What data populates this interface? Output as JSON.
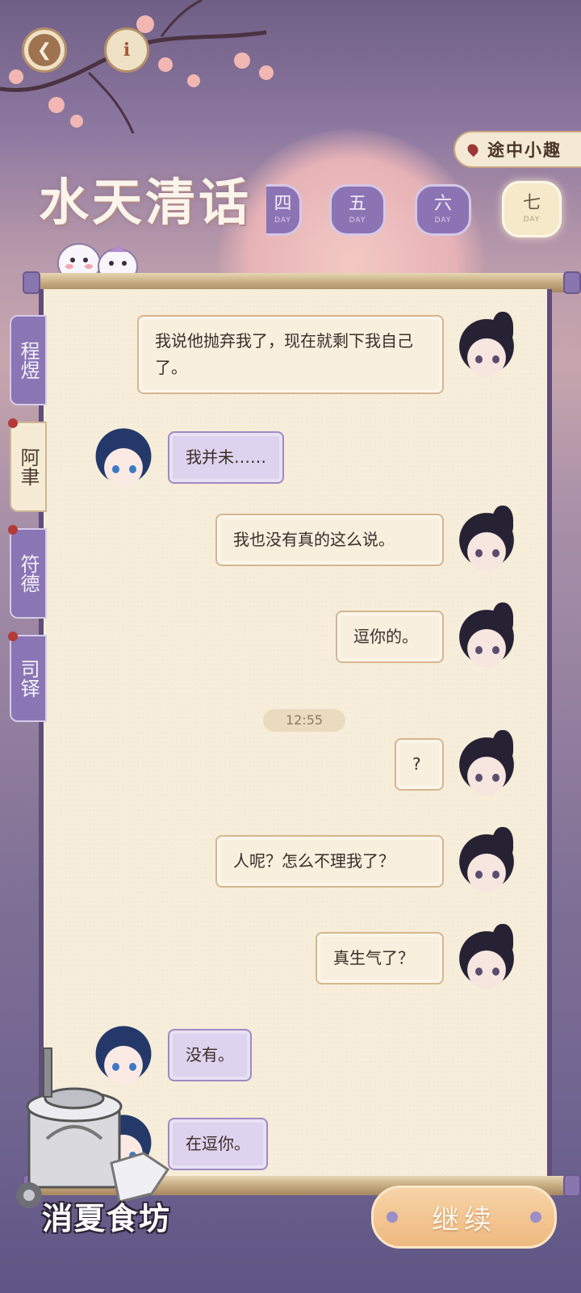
{
  "header": {
    "back_icon": "back-arrow-icon",
    "info_label": "i",
    "travel_tab_label": "途中小趣",
    "game_title": "水天清话"
  },
  "days": [
    {
      "num": "四",
      "label": "DAY",
      "state": "partial"
    },
    {
      "num": "五",
      "label": "DAY",
      "state": "normal"
    },
    {
      "num": "六",
      "label": "DAY",
      "state": "normal"
    },
    {
      "num": "七",
      "label": "DAY",
      "state": "active"
    }
  ],
  "side_tabs": [
    {
      "label": "程煜",
      "active": false,
      "marked": false
    },
    {
      "label": "阿聿",
      "active": true,
      "marked": true
    },
    {
      "label": "符德",
      "active": false,
      "marked": true
    },
    {
      "label": "司铎",
      "active": false,
      "marked": true
    }
  ],
  "chat": {
    "messages": [
      {
        "from": "me",
        "text": "我说他抛弃我了，现在就剩下我自己了。"
      },
      {
        "from": "other",
        "text": "我并未……"
      },
      {
        "from": "me",
        "text": "我也没有真的这么说。"
      },
      {
        "from": "me",
        "text": "逗你的。"
      },
      {
        "from": "me",
        "text": "?"
      },
      {
        "from": "me",
        "text": "人呢？怎么不理我了？"
      },
      {
        "from": "me",
        "text": "真生气了？"
      },
      {
        "from": "other",
        "text": "没有。"
      },
      {
        "from": "other",
        "text": "在逗你。"
      }
    ],
    "timestamp": "12:55"
  },
  "footer": {
    "shop_label": "消夏食坊",
    "continue_label": "继续"
  },
  "colors": {
    "accent_purple": "#8a76b4",
    "paper": "#f6edda",
    "continue_orange": "#eeb97f"
  }
}
